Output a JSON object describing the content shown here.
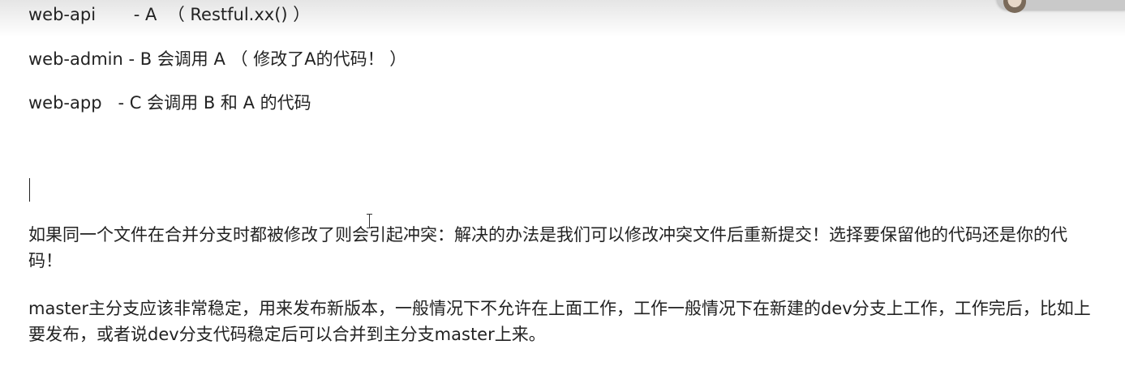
{
  "lines": [
    "web-api       - A  （ Restful.xx() ）",
    "web-admin - B 会调用 A （ 修改了A的代码！ ）",
    "web-app   - C 会调用 B 和 A 的代码"
  ],
  "paragraphs": [
    "如果同一个文件在合并分支时都被修改了则会引起冲突：解决的办法是我们可以修改冲突文件后重新提交！选择要保留他的代码还是你的代码！",
    "master主分支应该非常稳定，用来发布新版本，一般情况下不允许在上面工作，工作一般情况下在新建的dev分支上工作，工作完后，比如上要发布，或者说dev分支代码稳定后可以合并到主分支master上来。"
  ]
}
